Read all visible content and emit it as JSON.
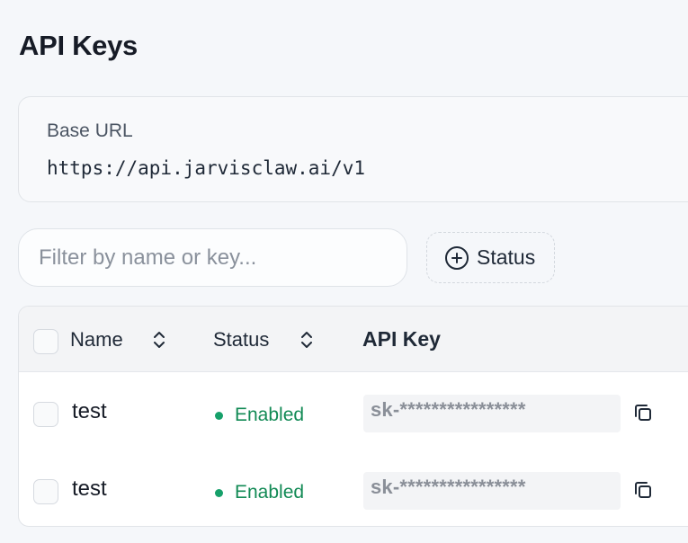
{
  "page": {
    "title": "API Keys"
  },
  "base": {
    "label": "Base URL",
    "url": "https://api.jarvisclaw.ai/v1"
  },
  "filter": {
    "placeholder": "Filter by name or key...",
    "value": ""
  },
  "status_filter": {
    "label": "Status",
    "icon": "plus-circle-icon"
  },
  "table": {
    "columns": {
      "name": "Name",
      "status": "Status",
      "api_key": "API Key"
    },
    "rows": [
      {
        "name": "test",
        "status": "Enabled",
        "key": "sk-****************"
      },
      {
        "name": "test",
        "status": "Enabled",
        "key": "sk-****************"
      }
    ]
  },
  "colors": {
    "enabled": "#16a06a",
    "background": "#f5f7fa"
  }
}
